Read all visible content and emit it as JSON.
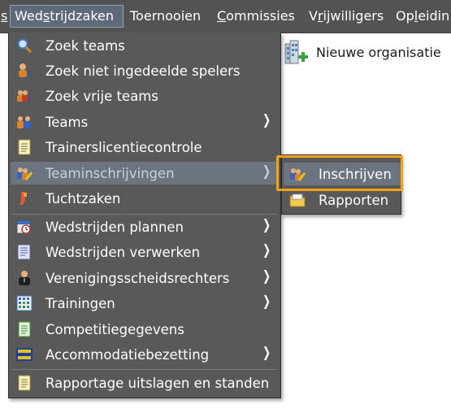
{
  "menubar": {
    "items": [
      {
        "label": "s",
        "underline": "s"
      },
      {
        "label": "Wedstrijdzaken",
        "pre": "Wed",
        "underline": "s",
        "post": "trijdzaken"
      },
      {
        "label": "Toernooien"
      },
      {
        "label": "Commissies",
        "pre": "",
        "underline": "C",
        "post": "ommissies"
      },
      {
        "label": "Vrijwilligers",
        "pre": "V",
        "underline": "r",
        "post": "ijwilligers"
      },
      {
        "label": "Opleidin",
        "pre": "Op",
        "underline": "l",
        "post": "eidin"
      }
    ]
  },
  "page": {
    "new_org_label": "Nieuwe organisatie"
  },
  "dropdown": {
    "items": [
      {
        "label": "Zoek teams",
        "icon": "magnifier-icon",
        "submenu": false
      },
      {
        "label": "Zoek niet ingedeelde spelers",
        "icon": "player-question-icon",
        "submenu": false
      },
      {
        "label": "Zoek vrije teams",
        "icon": "team-question-icon",
        "submenu": false
      },
      {
        "label": "Teams",
        "icon": "team-icon",
        "submenu": true
      },
      {
        "label": "Trainerslicentiecontrole",
        "icon": "document-icon",
        "submenu": false
      },
      {
        "label": "Teaminschrijvingen",
        "icon": "team-edit-icon",
        "submenu": true,
        "highlighted": true
      },
      {
        "label": "Tuchtzaken",
        "icon": "referee-card-icon",
        "submenu": false
      },
      {
        "label": "Wedstrijden plannen",
        "icon": "calendar-clock-icon",
        "submenu": true
      },
      {
        "label": "Wedstrijden verwerken",
        "icon": "form-icon",
        "submenu": true
      },
      {
        "label": "Verenigingsscheidsrechters",
        "icon": "referee-icon",
        "submenu": true
      },
      {
        "label": "Trainingen",
        "icon": "grid-schedule-icon",
        "submenu": true
      },
      {
        "label": "Competitiegegevens",
        "icon": "document-green-icon",
        "submenu": false
      },
      {
        "label": "Accommodatiebezetting",
        "icon": "field-icon",
        "submenu": true
      },
      {
        "label": "Rapportage uitslagen en standen",
        "icon": "report-icon",
        "submenu": false
      }
    ],
    "arrow_glyph": "❯"
  },
  "submenu": {
    "items": [
      {
        "label": "Inschrijven",
        "icon": "team-edit-icon",
        "focused": true
      },
      {
        "label": "Rapporten",
        "icon": "folder-icon"
      }
    ]
  },
  "colors": {
    "menubar_bg": "#535353",
    "menu_bg": "#595959",
    "highlight_bg": "#6c7480",
    "focus_border": "#f6a416"
  }
}
